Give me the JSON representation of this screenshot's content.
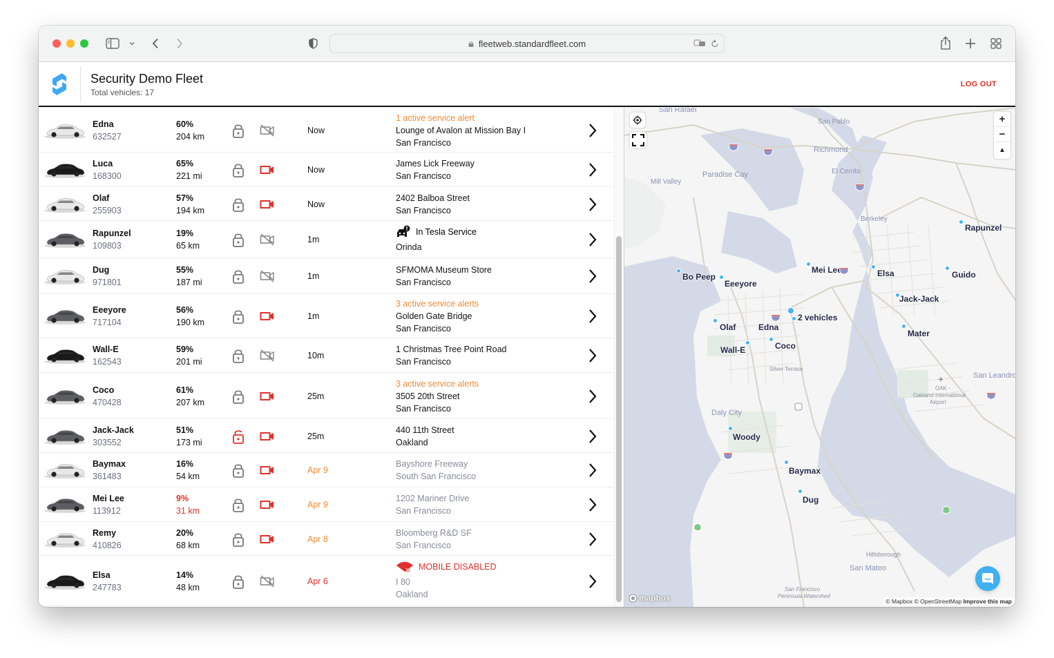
{
  "browser": {
    "url": "fleetweb.standardfleet.com",
    "icons": [
      "sidebar-icon",
      "chevron-down-icon",
      "back-icon",
      "forward-icon",
      "privacy-shield-icon",
      "lock-icon",
      "translate-icon",
      "reload-icon",
      "share-icon",
      "new-tab-icon",
      "tab-overview-icon"
    ]
  },
  "header": {
    "title": "Security Demo Fleet",
    "subtitle": "Total vehicles: 17",
    "logout_label": "LOG OUT"
  },
  "colors": {
    "accent_blue": "#47b3f0",
    "alert_orange": "#f28a30",
    "danger_red": "#e0302b",
    "muted_grey": "#868b98"
  },
  "vehicles": [
    {
      "name": "Edna",
      "vin": "632527",
      "battery": "60%",
      "range": "204 km",
      "locked": true,
      "camera": "off",
      "last_seen": "Now",
      "alert": "1 active service alert",
      "location": "Lounge of Avalon at Mission Bay I",
      "city": "San Francisco",
      "car_color": "white"
    },
    {
      "name": "Luca",
      "vin": "168300",
      "battery": "65%",
      "range": "221 mi",
      "locked": true,
      "camera": "on",
      "last_seen": "Now",
      "alert": "",
      "location": "James Lick Freeway",
      "city": "San Francisco",
      "car_color": "black"
    },
    {
      "name": "Olaf",
      "vin": "255903",
      "battery": "57%",
      "range": "194 km",
      "locked": true,
      "camera": "on",
      "last_seen": "Now",
      "alert": "",
      "location": "2402 Balboa Street",
      "city": "San Francisco",
      "car_color": "white"
    },
    {
      "name": "Rapunzel",
      "vin": "109803",
      "battery": "19%",
      "range": "65 km",
      "locked": true,
      "camera": "off",
      "last_seen": "1m",
      "status": "In Tesla Service",
      "location": "",
      "city": "Orinda",
      "car_color": "grey"
    },
    {
      "name": "Dug",
      "vin": "971801",
      "battery": "55%",
      "range": "187 mi",
      "locked": true,
      "camera": "off",
      "last_seen": "1m",
      "alert": "",
      "location": "SFMOMA Museum Store",
      "city": "San Francisco",
      "car_color": "white"
    },
    {
      "name": "Eeeyore",
      "vin": "717104",
      "battery": "56%",
      "range": "190 km",
      "locked": true,
      "camera": "on",
      "last_seen": "1m",
      "alert": "3 active service alerts",
      "location": "Golden Gate Bridge",
      "city": "San Francisco",
      "car_color": "grey"
    },
    {
      "name": "Wall-E",
      "vin": "162543",
      "battery": "59%",
      "range": "201 mi",
      "locked": true,
      "camera": "off",
      "last_seen": "10m",
      "alert": "",
      "location": "1 Christmas Tree Point Road",
      "city": "San Francisco",
      "car_color": "black"
    },
    {
      "name": "Coco",
      "vin": "470428",
      "battery": "61%",
      "range": "207 km",
      "locked": true,
      "camera": "on",
      "last_seen": "25m",
      "alert": "3 active service alerts",
      "location": "3505 20th Street",
      "city": "San Francisco",
      "car_color": "grey"
    },
    {
      "name": "Jack-Jack",
      "vin": "303552",
      "battery": "51%",
      "range": "173 mi",
      "locked": false,
      "camera": "on",
      "last_seen": "25m",
      "alert": "",
      "location": "440 11th Street",
      "city": "Oakland",
      "car_color": "grey"
    },
    {
      "name": "Baymax",
      "vin": "361483",
      "battery": "16%",
      "range": "54 km",
      "locked": true,
      "camera": "on",
      "last_seen": "Apr 9",
      "alert": "",
      "location": "Bayshore Freeway",
      "city": "South San Francisco",
      "car_color": "white",
      "stale": true
    },
    {
      "name": "Mei Lee",
      "vin": "113912",
      "battery": "9%",
      "range": "31 km",
      "locked": true,
      "camera": "on",
      "last_seen": "Apr 9",
      "alert": "",
      "location": "1202 Mariner Drive",
      "city": "San Francisco",
      "car_color": "grey",
      "stale": true,
      "low_battery": true
    },
    {
      "name": "Remy",
      "vin": "410826",
      "battery": "20%",
      "range": "68 km",
      "locked": true,
      "camera": "on",
      "last_seen": "Apr 8",
      "alert": "",
      "location": "Bloomberg R&D SF",
      "city": "San Francisco",
      "car_color": "white",
      "stale": true
    },
    {
      "name": "Elsa",
      "vin": "247783",
      "battery": "14%",
      "range": "48 km",
      "locked": true,
      "camera": "off",
      "last_seen": "Apr 6",
      "status": "MOBILE DISABLED",
      "location": "I 80",
      "city": "Oakland",
      "car_color": "black",
      "stale": true,
      "very_stale": true
    }
  ],
  "map": {
    "place_labels": [
      "San Rafael",
      "San Pablo",
      "Richmond",
      "El Cerrito",
      "Mill Valley",
      "Paradise Cay",
      "Berkeley",
      "Silver Terrace",
      "Daly City",
      "San Leandro",
      "OAK -",
      "Oakland International",
      "Airport",
      "Hillsborough",
      "San Mateo",
      "San Francisco",
      "Peninsula Watershed"
    ],
    "vehicle_markers": [
      "Rapunzel",
      "Mei Lee",
      "Elsa",
      "Guido",
      "Bo Peep",
      "Eeeyore",
      "Jack-Jack",
      "2 vehicles",
      "Olaf",
      "Edna",
      "Mater",
      "Wall-E",
      "Coco",
      "Woody",
      "Baymax",
      "Dug"
    ],
    "highway_shields": [
      "580",
      "580",
      "580",
      "80",
      "80",
      "101",
      "101",
      "280",
      "280",
      "880",
      "1",
      "13"
    ],
    "zoom_in": "+",
    "zoom_out": "−",
    "compass": "▲",
    "mapbox_logo": "mapbox",
    "attribution": "© Mapbox © OpenStreetMap",
    "improve_link": "Improve this map"
  }
}
